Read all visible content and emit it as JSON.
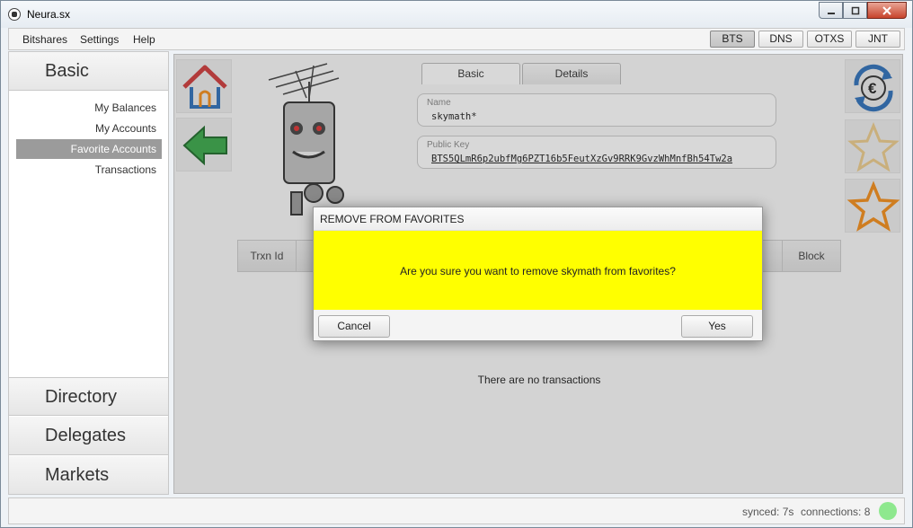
{
  "window": {
    "title": "Neura.sx"
  },
  "menu": {
    "items": [
      "Bitshares",
      "Settings",
      "Help"
    ]
  },
  "network_tabs": [
    {
      "label": "BTS",
      "active": true
    },
    {
      "label": "DNS",
      "active": false
    },
    {
      "label": "OTXS",
      "active": false
    },
    {
      "label": "JNT",
      "active": false
    }
  ],
  "sidebar": {
    "top_section": "Basic",
    "links": [
      "My Balances",
      "My Accounts",
      "Favorite Accounts",
      "Transactions"
    ],
    "selected_link": "Favorite Accounts",
    "bottom_sections": [
      "Directory",
      "Delegates",
      "Markets"
    ]
  },
  "account": {
    "tabs": [
      {
        "label": "Basic",
        "active": true
      },
      {
        "label": "Details",
        "active": false
      }
    ],
    "name_label": "Name",
    "name_value": "skymath*",
    "key_label": "Public Key",
    "key_value": "BTS5QLmR6p2ubfMg6PZT16b5FeutXzGv9RRK9GvzWhMnfBh54Tw2a"
  },
  "table": {
    "columns": [
      "Trxn Id",
      "Block"
    ],
    "empty_message": "There are no transactions"
  },
  "dialog": {
    "title": "REMOVE FROM FAVORITES",
    "message": "Are you sure you want to remove skymath from favorites?",
    "cancel_label": "Cancel",
    "confirm_label": "Yes"
  },
  "status": {
    "synced": "synced: 7s",
    "connections": "connections: 8",
    "indicator_color": "#8ee88e"
  },
  "icons": {
    "home": "home-icon",
    "back": "back-arrow-icon",
    "currency": "euro-exchange-icon",
    "favorite_disabled": "star-outline-icon",
    "favorite": "star-icon",
    "robot": "robot-avatar-icon"
  },
  "colors": {
    "dialog_body": "#ffff00",
    "selected_link": "#9b9b9b",
    "home_roof": "#cc3b3b",
    "back_arrow": "#3aa64a",
    "star_orange": "#f08c1a"
  }
}
